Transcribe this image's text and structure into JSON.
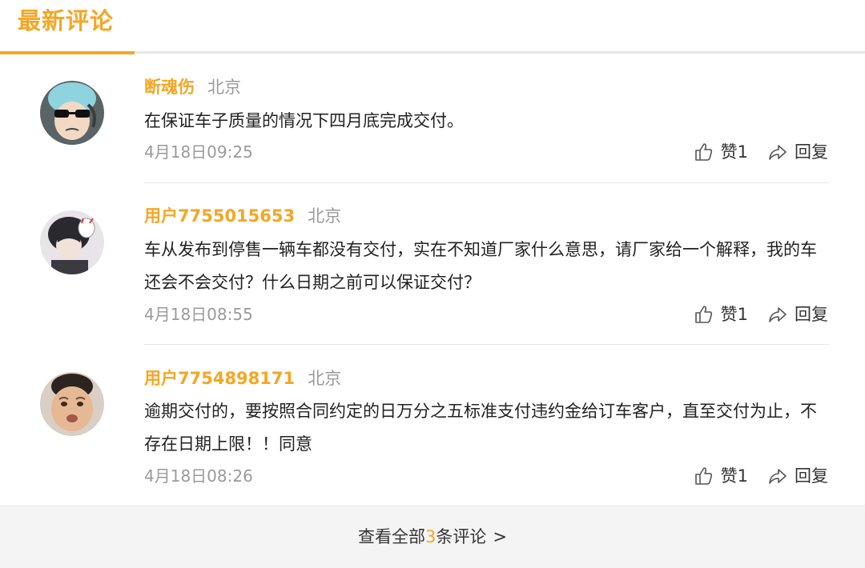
{
  "section": {
    "title": "最新评论"
  },
  "comments": [
    {
      "user": "断魂伤",
      "location": "北京",
      "text": "在保证车子质量的情况下四月底完成交付。",
      "time": "4月18日09:25",
      "like_label": "赞1",
      "reply_label": "回复"
    },
    {
      "user": "用户7755015653",
      "location": "北京",
      "text": "车从发布到停售一辆车都没有交付，实在不知道厂家什么意思，请厂家给一个解释，我的车还会不会交付？什么日期之前可以保证交付？",
      "time": "4月18日08:55",
      "like_label": "赞1",
      "reply_label": "回复"
    },
    {
      "user": "用户7754898171",
      "location": "北京",
      "text": "逾期交付的，要按照合同约定的日万分之五标准支付违约金给订车客户，直至交付为止，不存在日期上限！！同意",
      "time": "4月18日08:26",
      "like_label": "赞1",
      "reply_label": "回复"
    }
  ],
  "footer": {
    "prefix": "查看全部",
    "count": "3",
    "suffix": "条评论",
    "chevron": ">"
  },
  "colors": {
    "accent": "#f5a623",
    "muted": "#9a9a9a",
    "footer_bg": "#f4f4f4"
  },
  "icons": {
    "like": "thumbs-up-icon",
    "reply": "reply-arrow-icon"
  }
}
